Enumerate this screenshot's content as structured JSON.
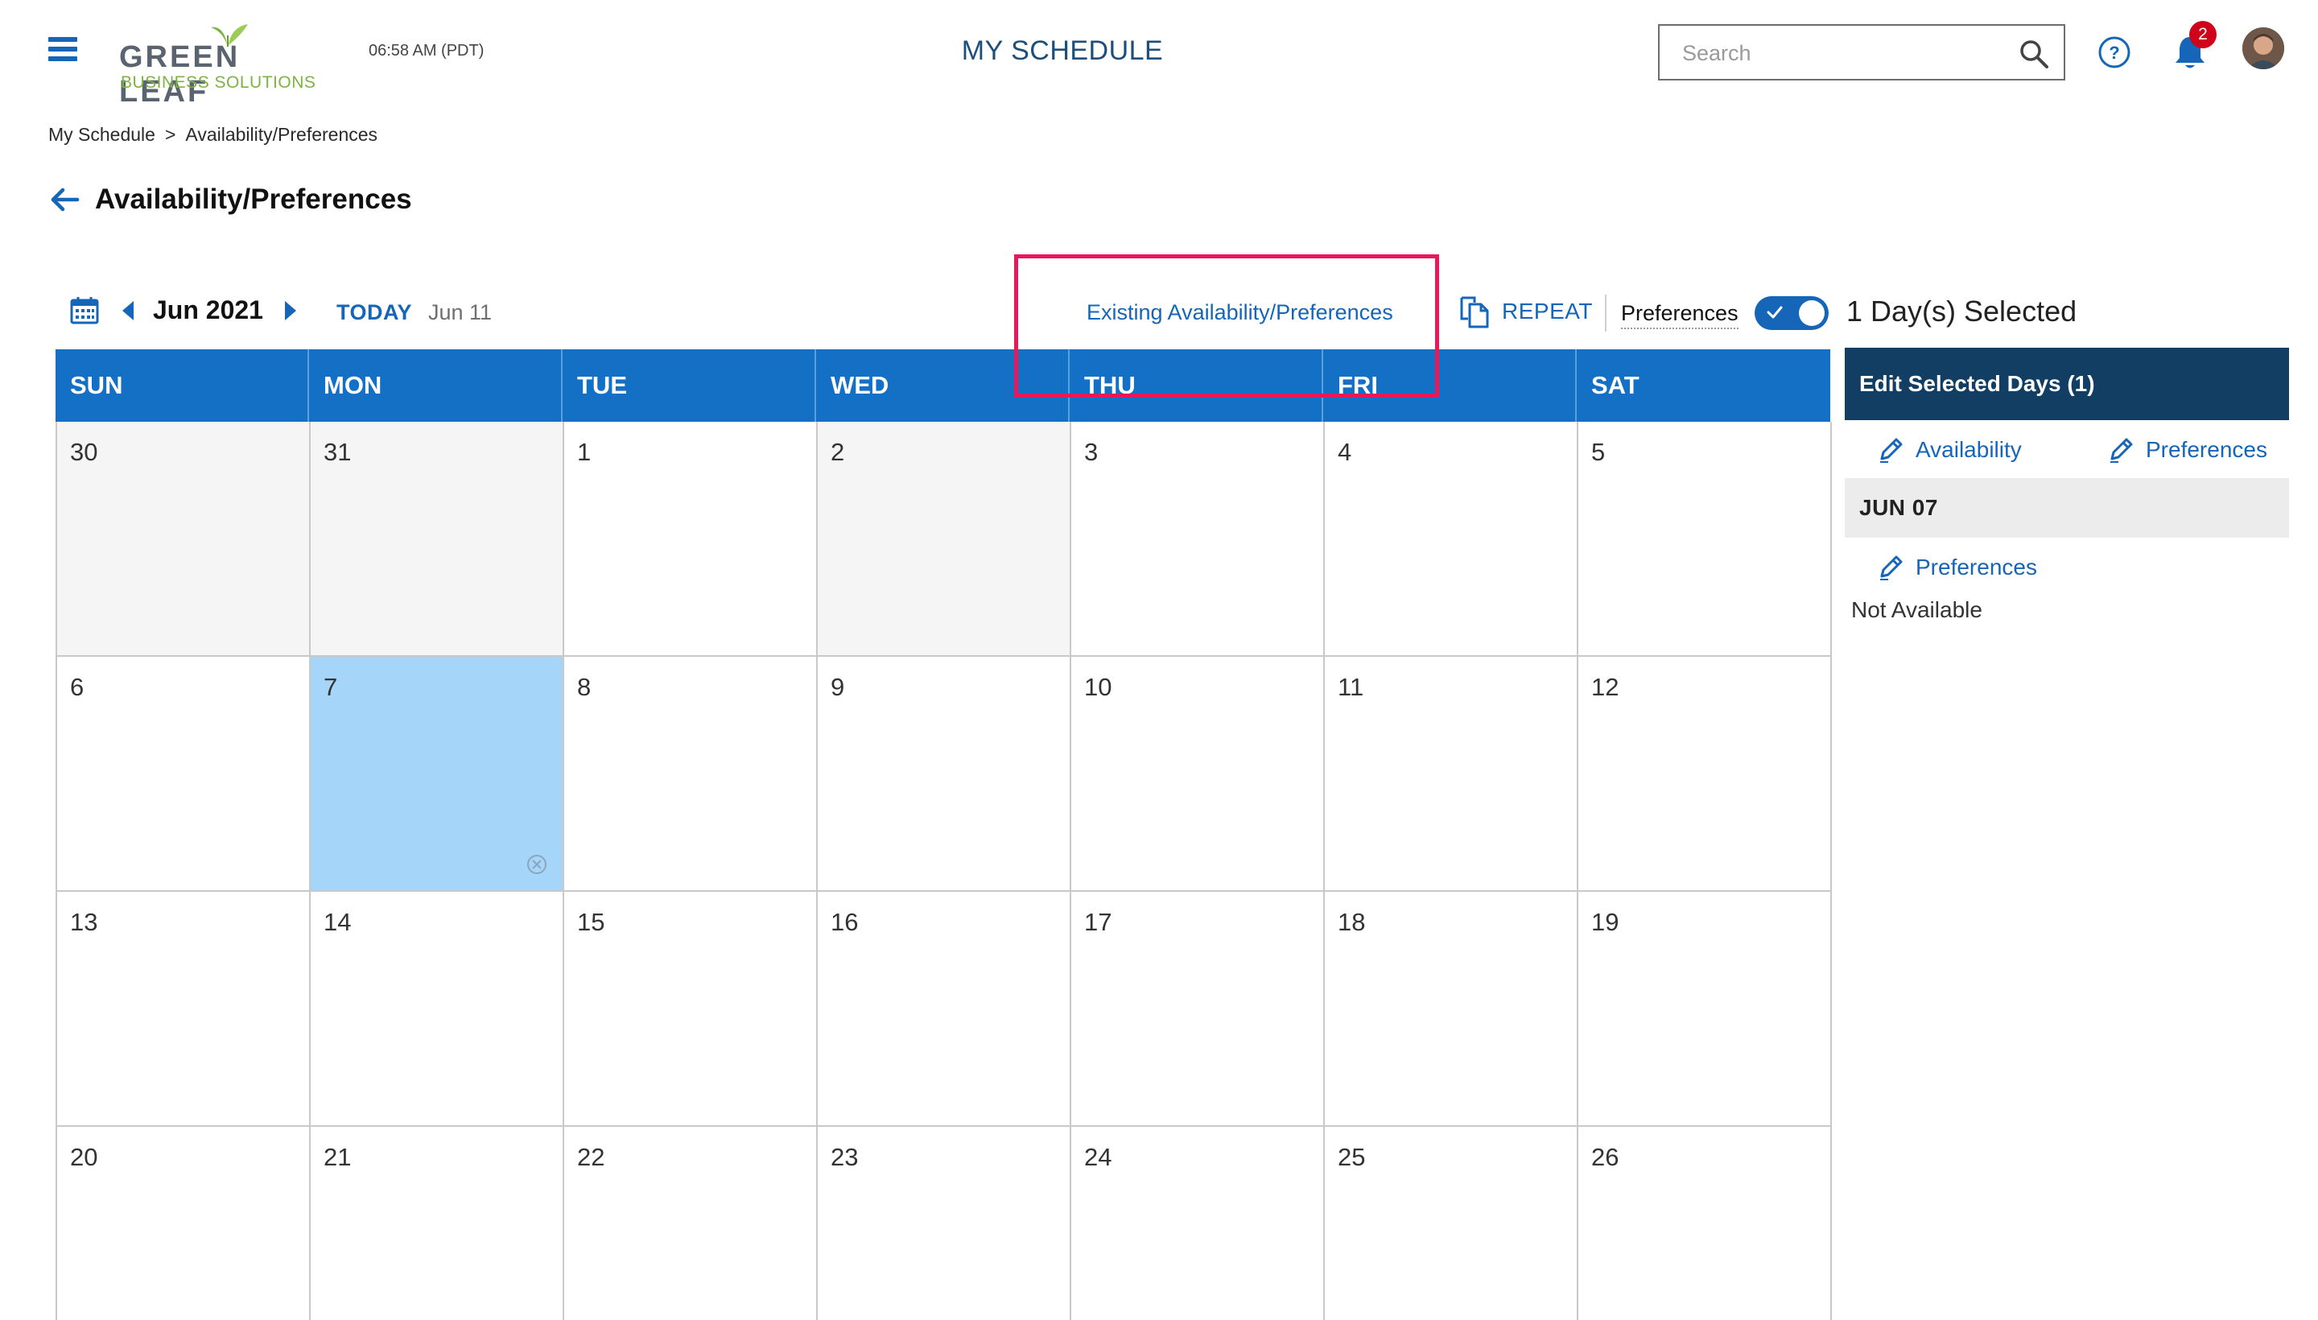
{
  "header": {
    "logo_top": "GREEN",
    "logo_top2": "LEAF",
    "logo_sub": "BUSINESS SOLUTIONS",
    "time": "06:58 AM (PDT)",
    "title": "MY SCHEDULE",
    "search_placeholder": "Search",
    "notification_count": "2"
  },
  "breadcrumb": {
    "root": "My Schedule",
    "separator": ">",
    "current": "Availability/Preferences"
  },
  "page": {
    "title": "Availability/Preferences"
  },
  "toolbar": {
    "month": "Jun 2021",
    "today_label": "TODAY",
    "today_date": "Jun 11",
    "existing_link": "Existing Availability/Preferences",
    "repeat_label": "REPEAT",
    "preferences_label": "Preferences",
    "preferences_toggle_on": true,
    "selected_count": "1 Day(s) Selected"
  },
  "calendar": {
    "weekdays": [
      "SUN",
      "MON",
      "TUE",
      "WED",
      "THU",
      "FRI",
      "SAT"
    ],
    "weeks": [
      [
        "30",
        "31",
        "1",
        "2",
        "3",
        "4",
        "5"
      ],
      [
        "6",
        "7",
        "8",
        "9",
        "10",
        "11",
        "12"
      ],
      [
        "13",
        "14",
        "15",
        "16",
        "17",
        "18",
        "19"
      ],
      [
        "20",
        "21",
        "22",
        "23",
        "24",
        "25",
        "26"
      ]
    ],
    "past_days": [
      "30",
      "31",
      "2"
    ],
    "selected_day": "7"
  },
  "panel": {
    "header": "Edit Selected Days (1)",
    "availability_label": "Availability",
    "preferences_label": "Preferences",
    "date": "JUN 07",
    "date_preferences_label": "Preferences",
    "status": "Not Available"
  },
  "colors": {
    "primary_blue": "#1370c4",
    "link_blue": "#1565b8",
    "panel_header": "#123e64",
    "selected_day": "#a5d6fa",
    "highlight": "#e8195a",
    "logo_green": "#7db342"
  }
}
